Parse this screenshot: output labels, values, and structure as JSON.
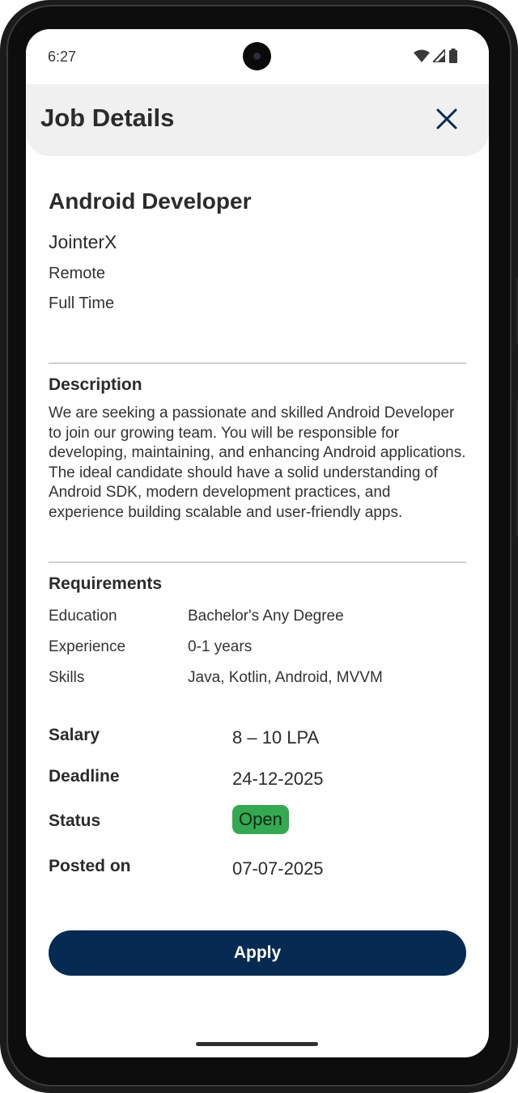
{
  "status_bar": {
    "time": "6:27",
    "icons": [
      "wifi-icon",
      "signal-icon",
      "battery-icon"
    ]
  },
  "app_bar": {
    "title": "Job Details",
    "close_icon": "close-icon"
  },
  "job": {
    "title": "Android Developer",
    "company": "JointerX",
    "location": "Remote",
    "type": "Full Time"
  },
  "description": {
    "heading": "Description",
    "text": "We are seeking a passionate and skilled Android Developer to join our growing team. You will be responsible for developing, maintaining, and enhancing Android applications. The ideal candidate should have a solid understanding of Android SDK, modern development practices, and experience building scalable and user-friendly apps."
  },
  "requirements": {
    "heading": "Requirements",
    "items": [
      {
        "label": "Education",
        "value": "Bachelor's Any Degree"
      },
      {
        "label": "Experience",
        "value": "0-1 years"
      },
      {
        "label": "Skills",
        "value": "Java, Kotlin, Android, MVVM"
      }
    ]
  },
  "details": {
    "salary_label": "Salary",
    "salary_value": "8 – 10 LPA",
    "deadline_label": "Deadline",
    "deadline_value": "24-12-2025",
    "status_label": "Status",
    "status_value": "Open",
    "posted_label": "Posted on",
    "posted_value": "07-07-2025"
  },
  "actions": {
    "apply_label": "Apply"
  },
  "colors": {
    "primary": "#062a52",
    "status_open": "#34a853",
    "app_bar_bg": "#f0f0f0",
    "divider": "#cfcfcf"
  }
}
